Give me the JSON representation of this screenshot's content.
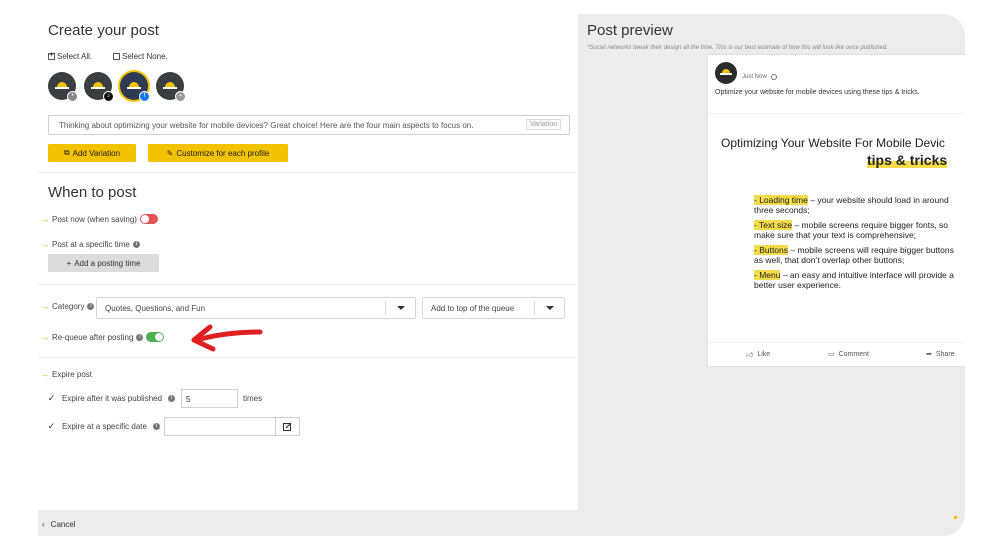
{
  "create": {
    "title": "Create your post",
    "select_all": "Select All.",
    "select_none": "Select None.",
    "profiles": [
      {
        "icon": "brand-logo-icon",
        "badge": "link-badge-icon"
      },
      {
        "icon": "brand-logo-icon",
        "badge": "tiktok-badge-icon"
      },
      {
        "icon": "brand-logo-icon",
        "badge": "facebook-badge-icon"
      },
      {
        "icon": "brand-logo-icon",
        "badge": "chat-badge-icon"
      }
    ],
    "post_text": "Thinking about optimizing your website for mobile devices? Great choice! Here are the four main aspects to focus on.",
    "variation_label": "Variation",
    "add_variation": "Add Variation",
    "customize": "Customize for each profile"
  },
  "when": {
    "title": "When to post",
    "post_now": "Post now (when saving)",
    "post_specific": "Post at a specific time",
    "add_time": "Add a posting time"
  },
  "category": {
    "label": "Category",
    "value": "Quotes, Questions, and Fun",
    "queue_option": "Add to top of the queue",
    "requeue": "Re-queue after posting"
  },
  "expire": {
    "label": "Expire post",
    "after_published": "Expire after it was published",
    "times_value": "5",
    "times_label": "times",
    "specific_date": "Expire at a specific date"
  },
  "preview": {
    "title": "Post preview",
    "disclaimer": "*Social networks tweak their design all the time. This is our best estimate of how this will look like once published.",
    "time": "Just Now",
    "caption": "Optimize your website for mobile devices using these tips & tricks.",
    "image_heading": "Optimizing Your Website For Mobile Devic",
    "image_sub": "tips & tricks",
    "tips": [
      {
        "hl": "- Loading time",
        "text": " – your website should load in around three seconds;"
      },
      {
        "hl": "- Text size",
        "text": " – mobile screens require bigger fonts, so make sure that your text is comprehensive;"
      },
      {
        "hl": "- Buttons",
        "text": " – mobile screens will require bigger buttons as well, that don’t overlap other buttons;"
      },
      {
        "hl": "- Menu",
        "text": " – an easy and intuitive interface will provide a better user experience."
      }
    ],
    "like": "Like",
    "comment": "Comment",
    "share": "Share"
  },
  "footer": {
    "cancel": "Cancel"
  },
  "colors": {
    "accent": "#f3c200",
    "toggle_off": "#e05555",
    "toggle_on": "#4caf50",
    "annotation_arrow": "#e02020"
  }
}
